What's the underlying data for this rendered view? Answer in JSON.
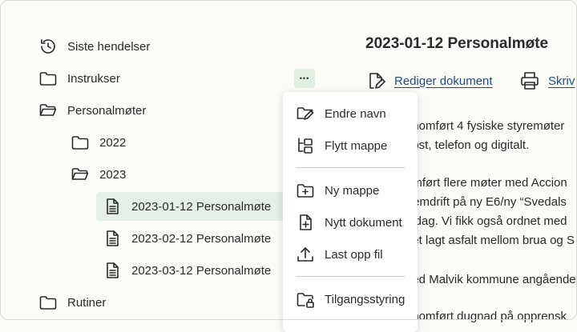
{
  "sidebar": {
    "recent_label": "Siste hendelser",
    "instructions_label": "Instrukser",
    "staff_meetings_label": "Personalmøter",
    "year_2022_label": "2022",
    "year_2023_label": "2023",
    "doc1_label": "2023-01-12 Personalmøte",
    "doc2_label": "2023-02-12 Personalmøte",
    "doc3_label": "2023-03-12 Personalmøte",
    "routines_label": "Rutiner"
  },
  "more_button_glyph": "•••",
  "context_menu": {
    "rename_label": "Endre navn",
    "move_label": "Flytt mappe",
    "new_folder_label": "Ny mappe",
    "new_document_label": "Nytt dokument",
    "upload_label": "Last opp fil",
    "access_label": "Tilgangsstyring"
  },
  "document": {
    "title": "2023-01-12 Personalmøte",
    "edit_label": "Rediger dokument",
    "print_label": "Skriv",
    "lines": [
      "nnomført 4 fysiske styremøter",
      "post, telefon og digitalt.",
      "omført flere møter med Accion",
      "fremdrift på ny E6/ny “Svedals",
      "iddag. Vi fikk også ordnet med",
      "det lagt asfalt mellom brua og S",
      "ned Malvik kommune angående",
      "nnomført dugnad på opprensk"
    ]
  },
  "colors": {
    "selected_bg": "#e6efe5",
    "link": "#1f4e86",
    "background": "#fbfbf7"
  }
}
